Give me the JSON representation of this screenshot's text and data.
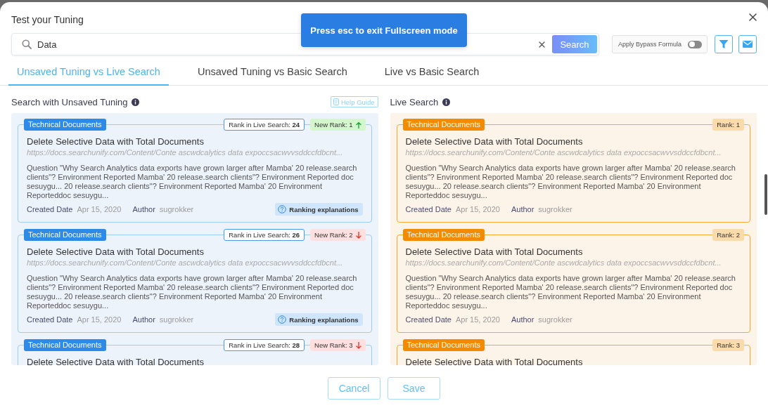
{
  "window": {
    "title": "Test your Tuning"
  },
  "fullscreen_notice": {
    "text": "Press esc to exit Fullscreen mode"
  },
  "search": {
    "value": "Data",
    "button": "Search"
  },
  "bypass": {
    "label": "Apply Bypass Formula",
    "on": false
  },
  "tabs": [
    {
      "label": "Unsaved Tuning vs Live Search",
      "selected": true
    },
    {
      "label": "Unsaved Tuning vs Basic Search",
      "selected": false
    },
    {
      "label": "Live vs Basic Search",
      "selected": false
    }
  ],
  "panels": [
    {
      "kind": "tuning",
      "title": "Search with Unsaved Tuning",
      "help_button": "Help Guide",
      "results": [
        {
          "tag": "Technical Documents",
          "live_rank": "Rank in Live Search: **24**",
          "new_rank": "New Rank: 1",
          "rank_up": true,
          "title": "Delete Selective Data with Total Documents",
          "url": "https://docs.searchunify.com/Content/Conte ascwdcalytics data expoccsacwvvsddccfdbcnt...",
          "description": "Question \"Why Search Analytics data exports have grown larger after Mamba' 20 release.search clients\"? Environment Reported Mamba' 20 release.search clients\"? Environment Reported doc sesuygu... 20 release.search clients\"? Environment Reported Mamba' 20 Environment Reporteddoc sesuygu...",
          "meta": [
            {
              "label": "Created Date",
              "value": "Apr 15, 2020"
            },
            {
              "label": "Author",
              "value": "sugrokker"
            }
          ],
          "explain_button": "Ranking explanations"
        },
        {
          "tag": "Technical Documents",
          "live_rank": "Rank in Live Search: **26**",
          "new_rank": "New Rank: 2",
          "rank_up": false,
          "title": "Delete Selective Data with Total Documents",
          "url": "https://docs.searchunify.com/Content/Conte ascwdcalytics data expoccsacwvvsddccfdbcnt...",
          "description": "Question \"Why Search Analytics data exports have grown larger after Mamba' 20 release.search clients\"? Environment Reported Mamba' 20 release.search clients\"? Environment Reported doc sesuygu... 20 release.search clients\"? Environment Reported Mamba' 20 Environment Reporteddoc sesuygu...",
          "meta": [
            {
              "label": "Created Date",
              "value": "Apr 15, 2020"
            },
            {
              "label": "Author",
              "value": "sugrokker"
            }
          ],
          "explain_button": "Ranking explanations"
        },
        {
          "tag": "Technical Documents",
          "live_rank": "Rank in Live Search: **28**",
          "new_rank": "New Rank: 3",
          "rank_up": false,
          "title": "Delete Selective Data with Total Documents"
        }
      ]
    },
    {
      "kind": "live",
      "title": "Live Search",
      "results": [
        {
          "tag": "Technical Documents",
          "rank": "Rank: 1",
          "title": "Delete Selective Data with Total Documents",
          "url": "https://docs.searchunify.com/Content/Conte ascwdcalytics data expoccsacwvvsddccfdbcnt...",
          "description": "Question \"Why Search Analytics data exports have grown larger after Mamba' 20 release.search clients\"? Environment Reported Mamba' 20 release.search clients\"? Environment Reported doc sesuygu... 20 release.search clients\"? Environment Reported Mamba' 20 Environment Reporteddoc sesuygu...",
          "meta": [
            {
              "label": "Created Date",
              "value": "Apr 15, 2020"
            },
            {
              "label": "Author",
              "value": "sugrokker"
            }
          ]
        },
        {
          "tag": "Technical Documents",
          "rank": "Rank: 2",
          "title": "Delete Selective Data with Total Documents",
          "url": "https://docs.searchunify.com/Content/Conte ascwdcalytics data expoccsacwvvsddccfdbcnt...",
          "description": "Question \"Why Search Analytics data exports have grown larger after Mamba' 20 release.search clients\"? Environment Reported Mamba' 20 release.search clients\"? Environment Reported doc sesuygu... 20 release.search clients\"? Environment Reported Mamba' 20 Environment Reporteddoc sesuygu...",
          "meta": [
            {
              "label": "Created Date",
              "value": "Apr 15, 2020"
            },
            {
              "label": "Author",
              "value": "sugrokker"
            }
          ]
        },
        {
          "tag": "Technical Documents",
          "rank": "Rank: 3",
          "title": "Delete Selective Data with Total Documents"
        }
      ]
    }
  ],
  "footer": {
    "buttons": [
      "Cancel",
      "Save"
    ]
  }
}
